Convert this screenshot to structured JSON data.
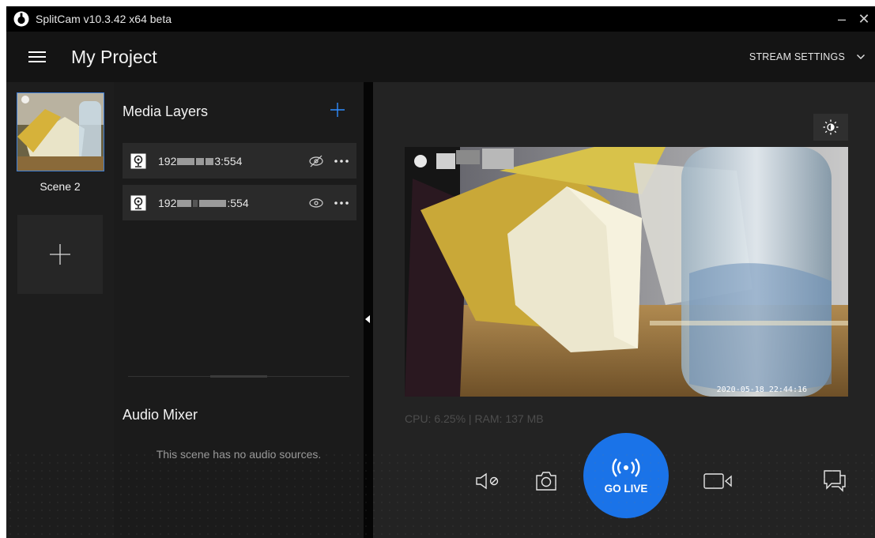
{
  "window": {
    "title": "SplitCam v10.3.42 x64 beta",
    "minimize_glyph": "–",
    "close_glyph": "✕",
    "accent_color": "#1a73e8"
  },
  "header": {
    "project_title": "My Project",
    "stream_settings_label": "STREAM SETTINGS"
  },
  "scenes": {
    "items": [
      {
        "label": "Scene 2",
        "selected": true
      }
    ],
    "add_icon": "plus-icon"
  },
  "media_layers": {
    "title": "Media Layers",
    "items": [
      {
        "name_prefix": "192",
        "name_suffix": "3:554",
        "visible": false,
        "icon": "webcam-icon"
      },
      {
        "name_prefix": "192",
        "name_suffix": ":554",
        "visible": true,
        "icon": "webcam-icon"
      }
    ]
  },
  "audio_mixer": {
    "title": "Audio Mixer",
    "empty_text": "This scene has no audio sources."
  },
  "preview": {
    "timestamp": "2020-05-18 22:44:16",
    "stats": "CPU: 6.25% | RAM: 137 MB"
  },
  "controls": {
    "go_live_label": "GO LIVE",
    "icons": [
      "mute-audio-icon",
      "camera-snapshot-icon",
      "broadcast-icon",
      "video-record-icon",
      "chat-icon"
    ]
  }
}
